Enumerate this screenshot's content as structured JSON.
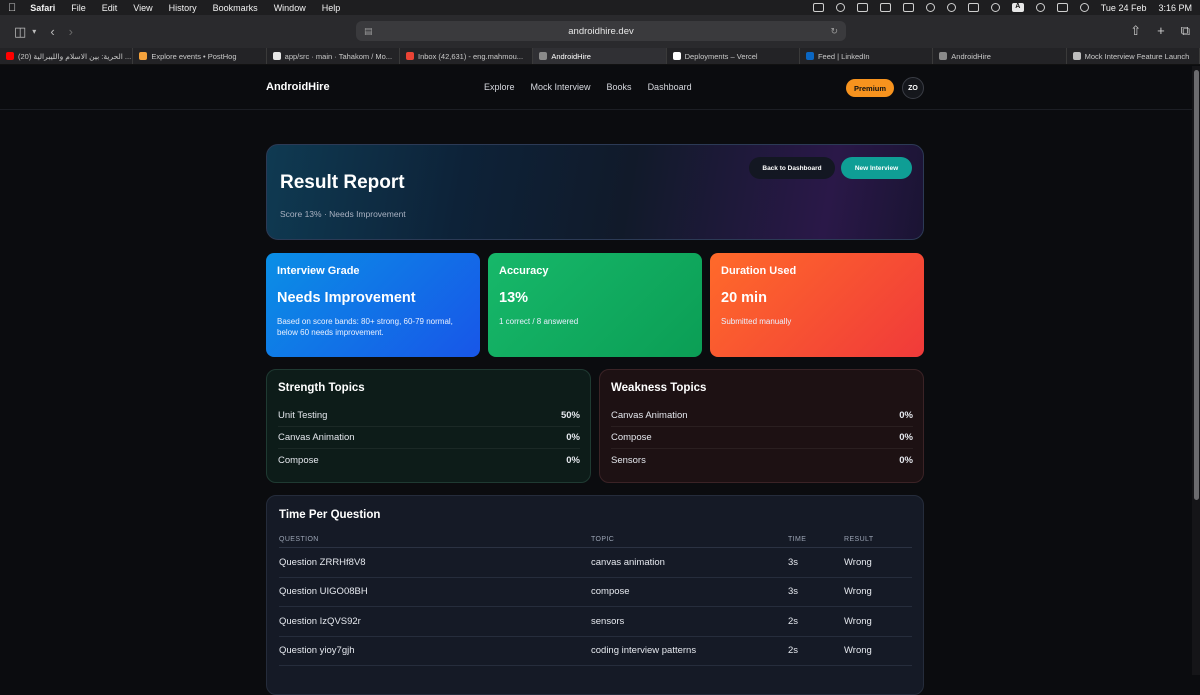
{
  "menubar": {
    "app": "Safari",
    "items": [
      "File",
      "Edit",
      "View",
      "History",
      "Bookmarks",
      "Window",
      "Help"
    ],
    "date": "Tue 24 Feb",
    "time": "3:16 PM",
    "input_indicator": "A"
  },
  "browser": {
    "url": "androidhire.dev",
    "tabs": [
      {
        "label": "(20) الحرية: بين الاسلام والليبرالية ...",
        "color": "#ff0000"
      },
      {
        "label": "Explore events • PostHog",
        "color": "#f4a23c"
      },
      {
        "label": "app/src · main · Tahakom / Mo...",
        "color": "#e6e6e6"
      },
      {
        "label": "Inbox (42,631) - eng.mahmou...",
        "color": "#ea4335"
      },
      {
        "label": "AndroidHire",
        "color": "#8a8a8a"
      },
      {
        "label": "Deployments – Vercel",
        "color": "#ffffff"
      },
      {
        "label": "Feed | LinkedIn",
        "color": "#0a66c2"
      },
      {
        "label": "AndroidHire",
        "color": "#8a8a8a"
      },
      {
        "label": "Mock Interview Feature Launch",
        "color": "#bdbdbd"
      }
    ],
    "active_tab_index": 4
  },
  "nav": {
    "brand": "AndroidHire",
    "links": [
      "Explore",
      "Mock Interview",
      "Books",
      "Dashboard"
    ],
    "premium_label": "Premium",
    "avatar_initials": "ZO"
  },
  "hero": {
    "title": "Result Report",
    "subtitle": "Score 13% · Needs Improvement",
    "back_label": "Back to Dashboard",
    "new_label": "New Interview"
  },
  "cards": [
    {
      "title": "Interview Grade",
      "value": "Needs Improvement",
      "note": "Based on score bands: 80+ strong, 60-79 normal, below 60 needs improvement."
    },
    {
      "title": "Accuracy",
      "value": "13%",
      "note": "1 correct / 8 answered"
    },
    {
      "title": "Duration Used",
      "value": "20 min",
      "note": "Submitted manually"
    }
  ],
  "strength": {
    "title": "Strength Topics",
    "rows": [
      {
        "topic": "Unit Testing",
        "pct": "50%"
      },
      {
        "topic": "Canvas Animation",
        "pct": "0%"
      },
      {
        "topic": "Compose",
        "pct": "0%"
      }
    ]
  },
  "weakness": {
    "title": "Weakness Topics",
    "rows": [
      {
        "topic": "Canvas Animation",
        "pct": "0%"
      },
      {
        "topic": "Compose",
        "pct": "0%"
      },
      {
        "topic": "Sensors",
        "pct": "0%"
      }
    ]
  },
  "time_per_question": {
    "title": "Time Per Question",
    "headers": [
      "QUESTION",
      "TOPIC",
      "TIME",
      "RESULT"
    ],
    "rows": [
      {
        "question": "Question ZRRHf8V8",
        "topic": "canvas animation",
        "time": "3s",
        "result": "Wrong"
      },
      {
        "question": "Question UIGO08BH",
        "topic": "compose",
        "time": "3s",
        "result": "Wrong"
      },
      {
        "question": "Question IzQVS92r",
        "topic": "sensors",
        "time": "2s",
        "result": "Wrong"
      },
      {
        "question": "Question yioy7gjh",
        "topic": "coding interview patterns",
        "time": "2s",
        "result": "Wrong"
      }
    ]
  }
}
